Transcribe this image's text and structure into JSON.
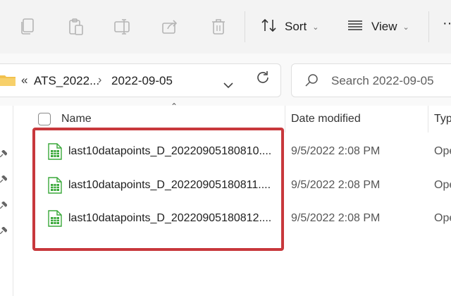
{
  "toolbar": {
    "icons": [
      "copy-icon",
      "paste-icon",
      "rename-icon",
      "share-icon",
      "delete-icon"
    ],
    "sort_label": "Sort",
    "view_label": "View",
    "more_label": "···"
  },
  "address": {
    "prefix": "«",
    "crumbs": [
      "ATS_2022...",
      "2022-09-05"
    ],
    "separator": "›"
  },
  "search": {
    "placeholder": "Search 2022-09-05"
  },
  "columns": {
    "name": "Name",
    "date_modified": "Date modified",
    "type": "Typ"
  },
  "files": [
    {
      "name": "last10datapoints_D_20220905180810....",
      "date": "9/5/2022 2:08 PM",
      "type": "Ope"
    },
    {
      "name": "last10datapoints_D_20220905180811....",
      "date": "9/5/2022 2:08 PM",
      "type": "Ope"
    },
    {
      "name": "last10datapoints_D_20220905180812....",
      "date": "9/5/2022 2:08 PM",
      "type": "Ope"
    }
  ],
  "colors": {
    "highlight": "#c8383c",
    "spreadsheet_icon": "#3aa83a",
    "folder": "#f2c14e"
  }
}
